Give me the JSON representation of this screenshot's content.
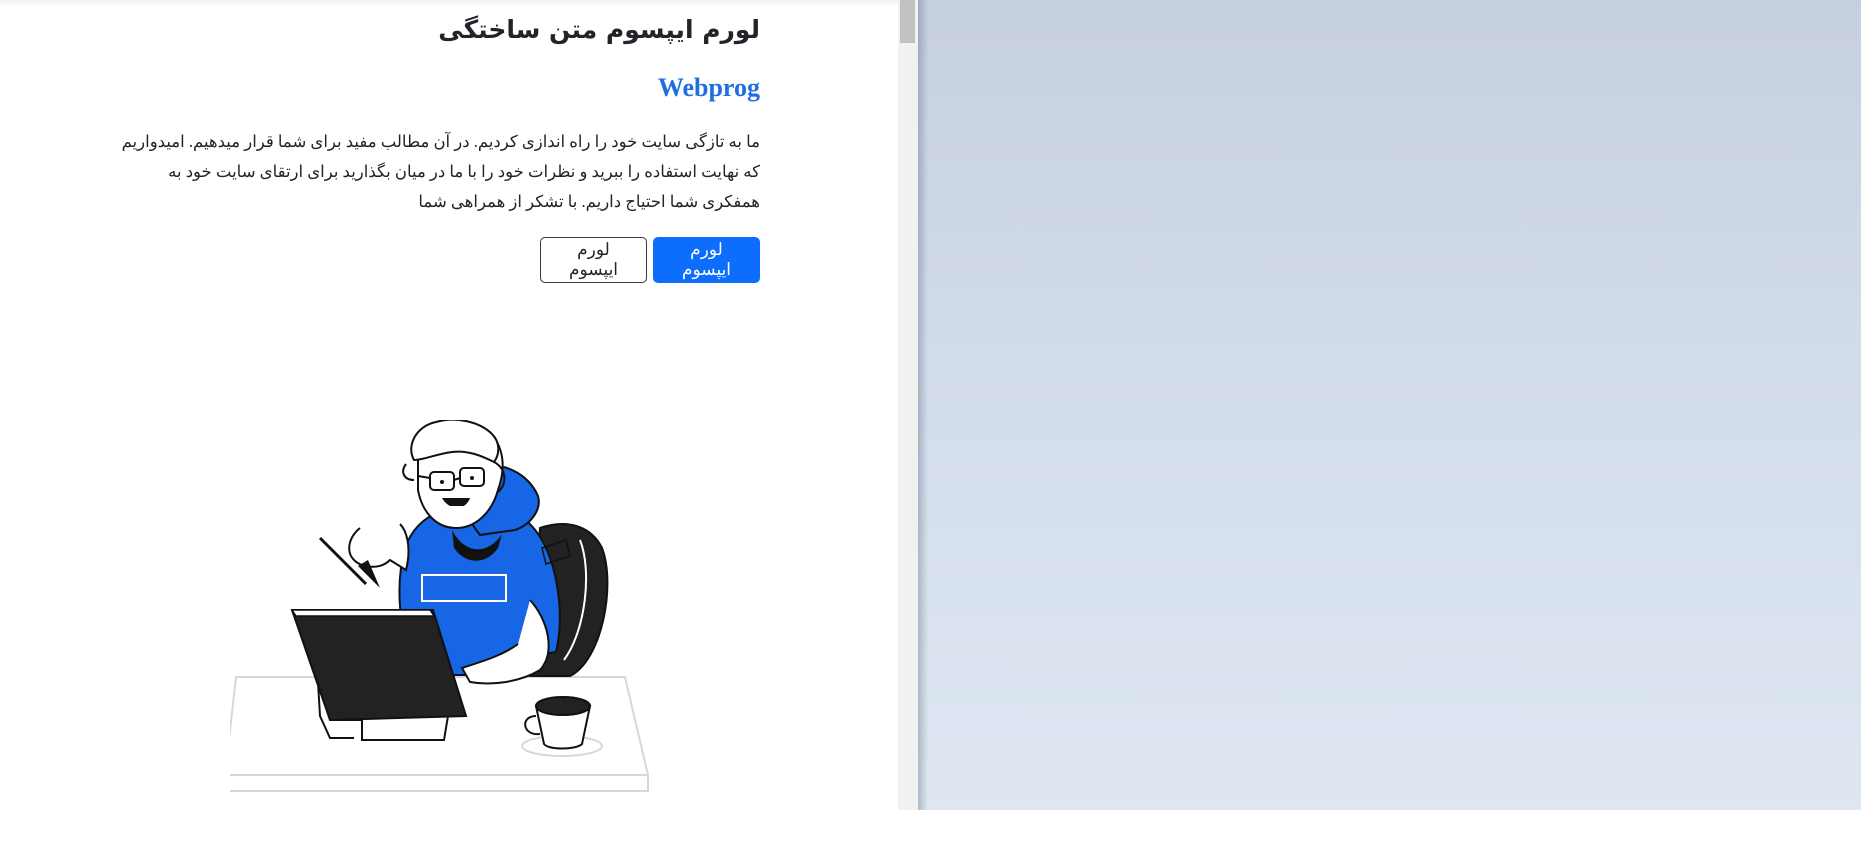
{
  "page": {
    "title": "لورم ایپسوم متن ساختگی",
    "brand": "Webprog",
    "description": "ما به تازگی سایت خود را راه اندازی کردیم. در آن مطالب مفید برای شما قرار میدهیم. امیدواریم که نهایت استفاده را ببرید و نظرات خود را با ما در میان بگذارید برای ارتقای سایت خود به همفکری شما احتیاج داریم. با تشکر از همراهی شما",
    "primary_button": "لورم ایپسوم",
    "secondary_button": "لورم ایپسوم"
  },
  "illustration": {
    "icon": "developer-at-laptop-illustration"
  },
  "colors": {
    "brand": "#1f6fe0",
    "primary": "#0d6efd",
    "hoodie": "#1766e5",
    "text": "#212529"
  }
}
